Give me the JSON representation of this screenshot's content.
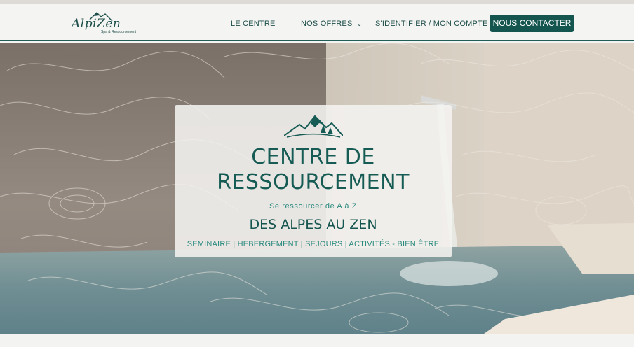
{
  "header": {
    "logo": {
      "name": "AlpiZen",
      "tagline": "Spa & Ressourcement",
      "icon": "mountain-logo-icon"
    },
    "nav": [
      {
        "label": "LE CENTRE"
      },
      {
        "label": "NOS OFFRES",
        "icon": "chevron-down-icon"
      },
      {
        "label": "S'IDENTIFIER / MON COMPTE"
      }
    ],
    "cta_label": "NOUS CONTACTER"
  },
  "hero": {
    "title_line1": "CENTRE DE",
    "title_line2": "RESSOURCEMENT",
    "subtitle": "Se ressourcer de A à Z",
    "heading2": "DES ALPES AU ZEN",
    "tags": "SEMINAIRE | HEBERGEMENT | SEJOURS | ACTIVITÉS - BIEN ÊTRE",
    "icon": "mountain-logo-icon"
  },
  "colors": {
    "brand": "#14564f",
    "accent": "#2a8a7e",
    "header_bg": "#f4f4f2"
  }
}
